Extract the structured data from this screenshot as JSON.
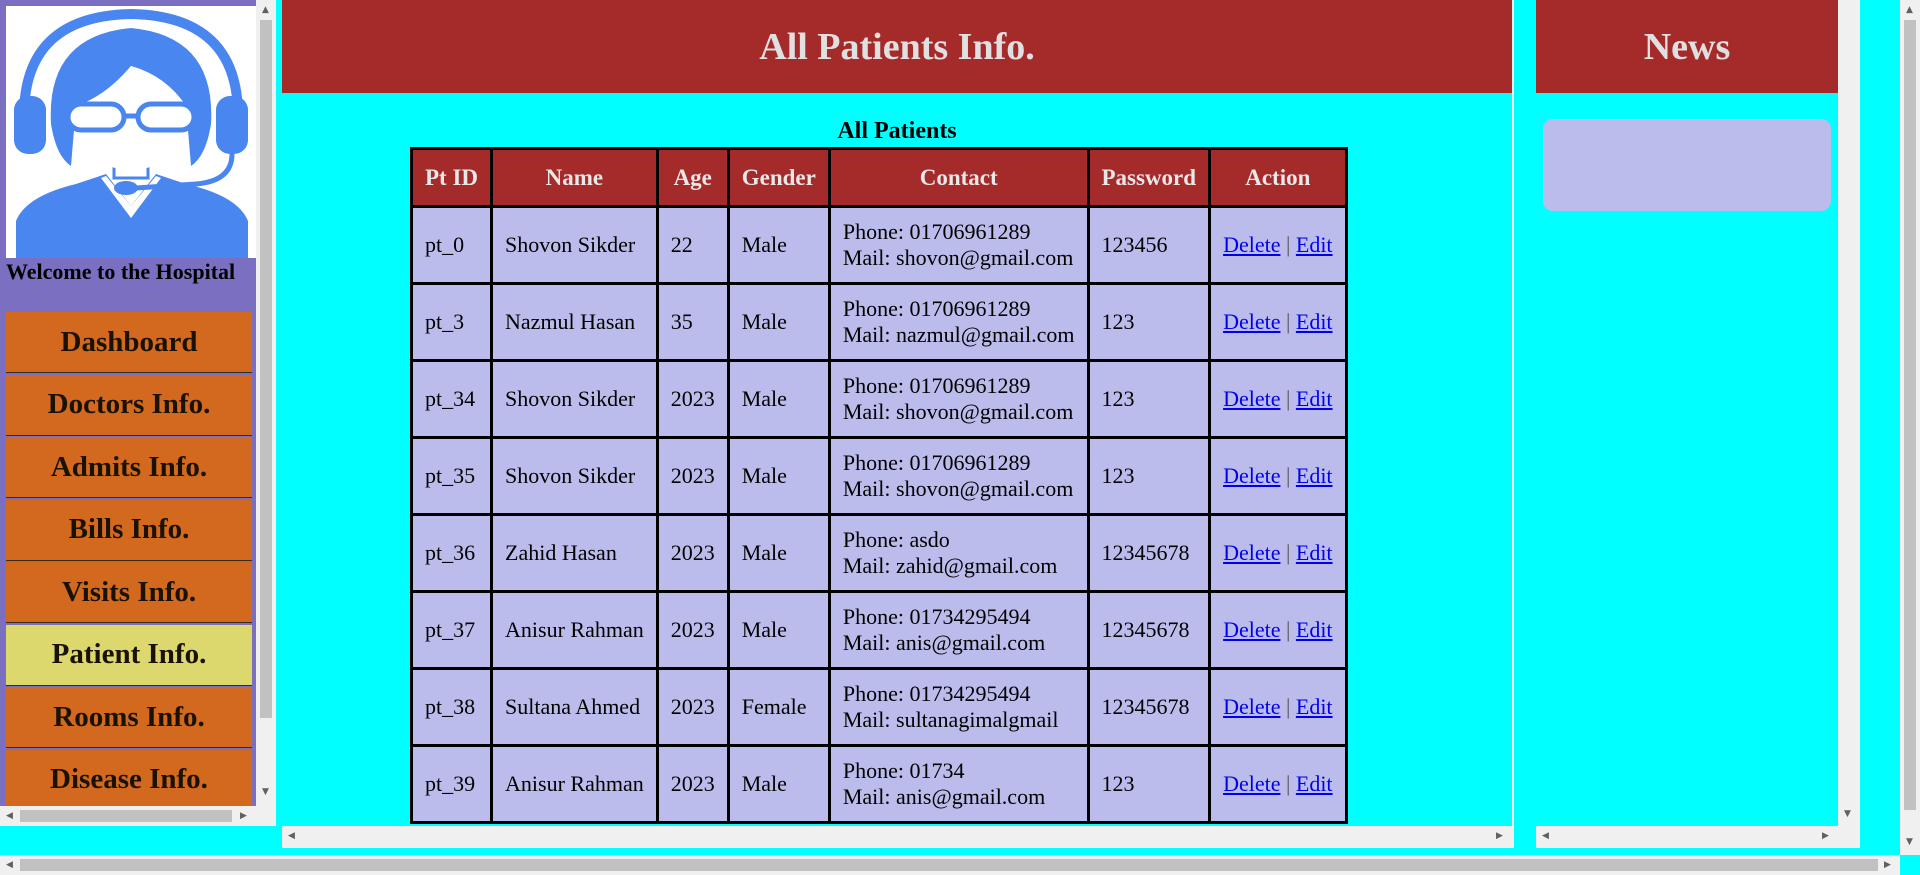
{
  "sidebar": {
    "welcome": "Welcome to the Hospital",
    "menu": [
      {
        "label": "Dashboard"
      },
      {
        "label": "Doctors Info."
      },
      {
        "label": "Admits Info."
      },
      {
        "label": "Bills Info."
      },
      {
        "label": "Visits Info."
      },
      {
        "label": "Patient Info.",
        "active": true
      },
      {
        "label": "Rooms Info."
      },
      {
        "label": "Disease Info."
      }
    ]
  },
  "main": {
    "title": "All Patients Info.",
    "table_caption": "All Patients",
    "columns": [
      "Pt ID",
      "Name",
      "Age",
      "Gender",
      "Contact",
      "Password",
      "Action"
    ],
    "rows": [
      {
        "id": "pt_0",
        "name": "Shovon Sikder",
        "age": "22",
        "gender": "Male",
        "phone": "Phone: 01706961289",
        "mail": "Mail: shovon@gmail.com",
        "password": "123456"
      },
      {
        "id": "pt_3",
        "name": "Nazmul Hasan",
        "age": "35",
        "gender": "Male",
        "phone": "Phone: 01706961289",
        "mail": "Mail: nazmul@gmail.com",
        "password": "123"
      },
      {
        "id": "pt_34",
        "name": "Shovon Sikder",
        "age": "2023",
        "gender": "Male",
        "phone": "Phone: 01706961289",
        "mail": "Mail: shovon@gmail.com",
        "password": "123"
      },
      {
        "id": "pt_35",
        "name": "Shovon Sikder",
        "age": "2023",
        "gender": "Male",
        "phone": "Phone: 01706961289",
        "mail": "Mail: shovon@gmail.com",
        "password": "123"
      },
      {
        "id": "pt_36",
        "name": "Zahid Hasan",
        "age": "2023",
        "gender": "Male",
        "phone": "Phone: asdo",
        "mail": "Mail: zahid@gmail.com",
        "password": "12345678"
      },
      {
        "id": "pt_37",
        "name": "Anisur Rahman",
        "age": "2023",
        "gender": "Male",
        "phone": "Phone: 01734295494",
        "mail": "Mail: anis@gmail.com",
        "password": "12345678"
      },
      {
        "id": "pt_38",
        "name": "Sultana Ahmed",
        "age": "2023",
        "gender": "Female",
        "phone": "Phone: 01734295494",
        "mail": "Mail: sultanagimalgmail",
        "password": "12345678"
      },
      {
        "id": "pt_39",
        "name": "Anisur Rahman",
        "age": "2023",
        "gender": "Male",
        "phone": "Phone: 01734",
        "mail": "Mail: anis@gmail.com",
        "password": "123"
      }
    ],
    "actions": {
      "delete": "Delete",
      "separator": "|",
      "edit": "Edit"
    }
  },
  "news": {
    "title": "News"
  },
  "colors": {
    "page_bg": "#00ffff",
    "header_bg": "#a52a2a",
    "sidebar_bg": "#7b6fc2",
    "menu_bg": "#d2691e",
    "menu_active_bg": "#dcd86e",
    "table_bg": "#bcbcec",
    "link": "#0000ee"
  },
  "icons": {
    "avatar": "support-agent-headset-avatar"
  }
}
